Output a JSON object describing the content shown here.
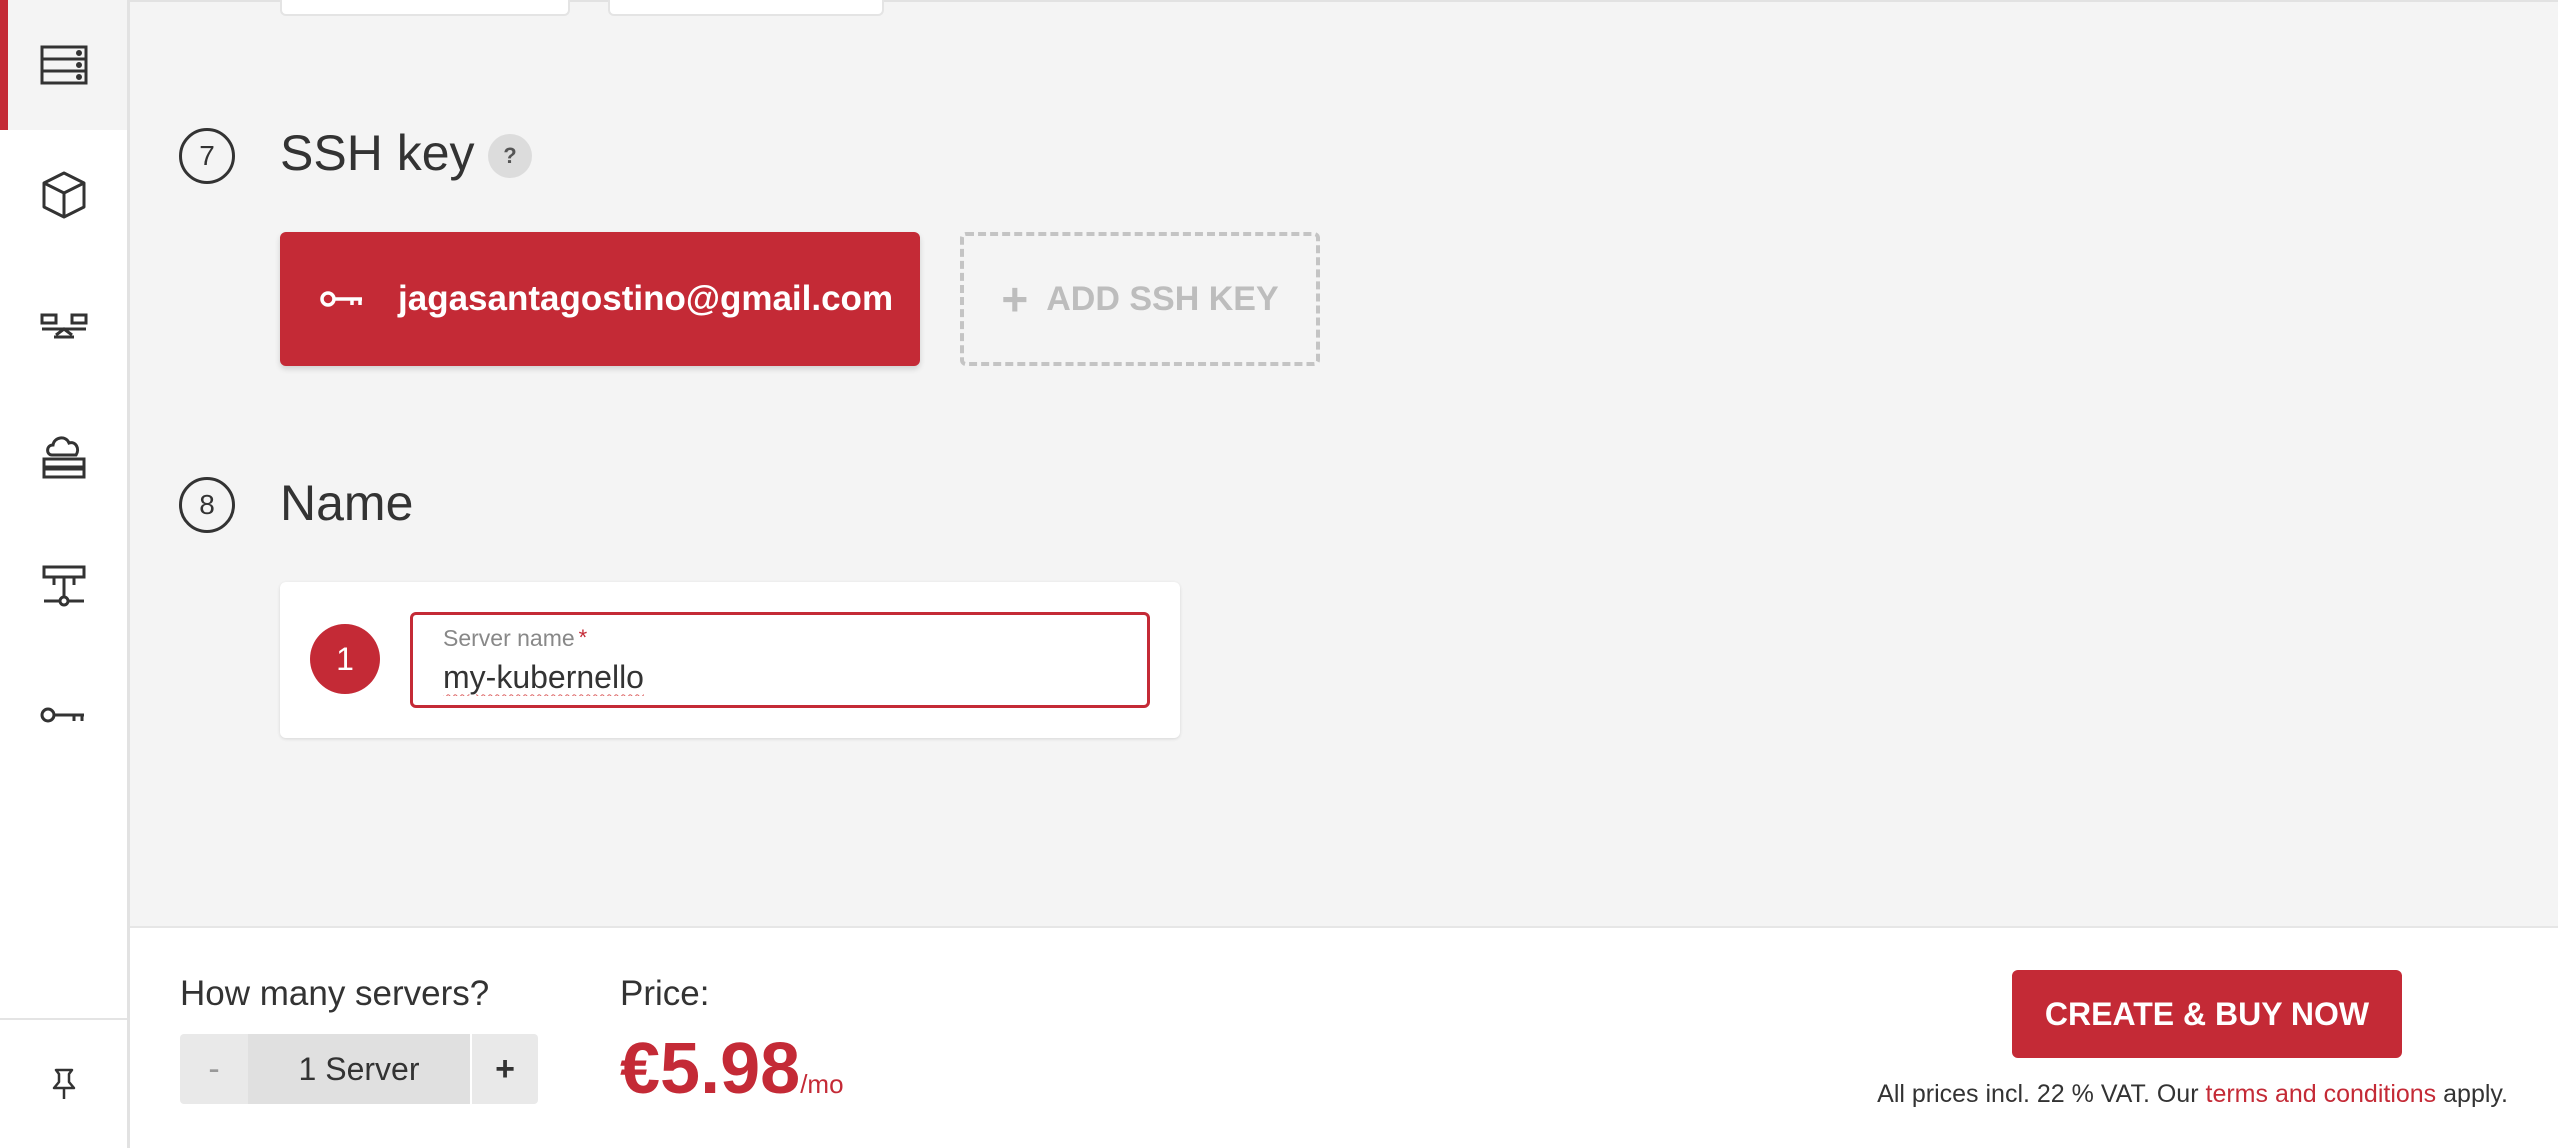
{
  "sidebar": {
    "items": [
      {
        "icon": "servers-icon",
        "active": true
      },
      {
        "icon": "cube-icon",
        "active": false
      },
      {
        "icon": "load-balancer-icon",
        "active": false
      },
      {
        "icon": "cloud-storage-icon",
        "active": false
      },
      {
        "icon": "network-icon",
        "active": false
      },
      {
        "icon": "key-icon",
        "active": false
      }
    ],
    "pin_icon": "pin-icon"
  },
  "ssh_section": {
    "step": "7",
    "title": "SSH key",
    "help": "?",
    "key_label": "jagasantagostino@gmail.com",
    "add_label": "ADD SSH KEY",
    "add_icon": "+"
  },
  "name_section": {
    "step": "8",
    "title": "Name",
    "server_index": "1",
    "field_label": "Server name",
    "required_mark": "*",
    "field_value": "my-kubernello"
  },
  "footer": {
    "qty_label": "How many servers?",
    "minus": "-",
    "plus": "+",
    "qty_value": "1 Server",
    "price_label": "Price:",
    "price_amount": "€5.98",
    "price_period": "/mo",
    "buy_label": "CREATE & BUY NOW",
    "vat_prefix": "All prices incl. 22 % VAT. Our ",
    "vat_link": "terms and conditions",
    "vat_suffix": " apply."
  },
  "colors": {
    "accent": "#c42a36",
    "background": "#f4f4f4"
  }
}
